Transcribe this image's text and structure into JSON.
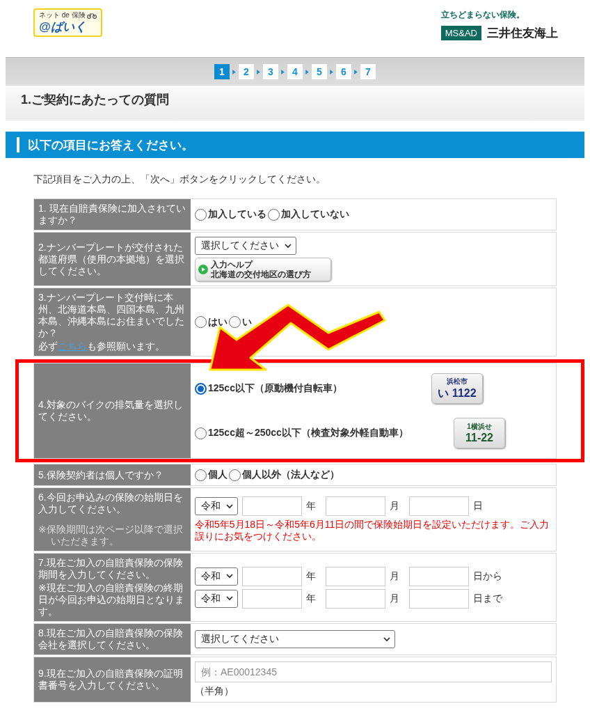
{
  "header": {
    "logo": {
      "tagline": "ネット de 保険",
      "name": "@ばいく"
    },
    "brand": {
      "slogan": "立ちどまらない保険。",
      "mark": "MS&AD",
      "company": "三井住友海上"
    }
  },
  "steps": [
    {
      "label": "1",
      "selected": true
    },
    {
      "label": "2",
      "selected": false
    },
    {
      "label": "3",
      "selected": false
    },
    {
      "label": "4",
      "selected": false
    },
    {
      "label": "5",
      "selected": false
    },
    {
      "label": "6",
      "selected": false
    },
    {
      "label": "7",
      "selected": false
    }
  ],
  "page_title": "1.ご契約にあたっての質問",
  "section_title": "以下の項目にお答えください。",
  "instructions": "下記項目をご入力の上、「次へ」ボタンをクリックしてください。",
  "questions": [
    {
      "kind": "radio",
      "label": "1. 現在自賠責保険に加入されていますか？",
      "highlighted": false,
      "options": [
        {
          "label": "加入している",
          "selected": false
        },
        {
          "label": "加入していない",
          "selected": false
        }
      ]
    },
    {
      "kind": "select",
      "label": "2.ナンバープレートが交付された都道府県（使用の本拠地）を選択してください。",
      "highlighted": false,
      "select": "選択してください",
      "help_button": {
        "line1": "入力ヘルプ",
        "line2": "北海道の交付地区の選び方"
      }
    },
    {
      "kind": "radio",
      "label": "3.ナンバープレート交付時に本州、北海道本島、四国本島、九州本島、沖縄本島にお住まいでしたか？",
      "note": {
        "before": "必ず",
        "link": "こちら",
        "after": "も参照願います。"
      },
      "highlighted": false,
      "options": [
        {
          "label": "はい",
          "selected": false
        },
        {
          "label": "い",
          "selected": false
        }
      ]
    },
    {
      "kind": "plates",
      "label": "4.対象のバイクの排気量を選択してください。",
      "highlighted": true,
      "options": [
        {
          "label": "125cc以下（原動機付自転車）",
          "selected": true,
          "plate": {
            "top": "浜松市",
            "bottom": "い 1122",
            "color": "#1f2c7c"
          }
        },
        {
          "label": "125cc超～250cc以下（検査対象外軽自動車）",
          "selected": false,
          "plate": {
            "top": "1横浜せ",
            "bottom": "11-22",
            "color": "#1f5a30"
          }
        }
      ]
    },
    {
      "kind": "radio",
      "label": "5.保険契約者は個人ですか？",
      "highlighted": false,
      "options": [
        {
          "label": "個人",
          "selected": false
        },
        {
          "label": "個人以外（法人など）",
          "selected": false
        }
      ]
    },
    {
      "kind": "date",
      "label": "6.今回お申込みの保険の始期日を入力してください。",
      "aside": "※保険期間は次ページ以降で選択いただきます。",
      "highlighted": false,
      "dates": [
        {
          "era": "令和",
          "year_unit": "年",
          "month_unit": "月",
          "day_unit": "日"
        }
      ],
      "warning": "令和5年5月18日～令和5年6月11日の間で保険始期日を設定いただけます。ご入力誤りにお気をつけください。"
    },
    {
      "kind": "date",
      "label": "7.現在ご加入の自賠責保険の保険期間を入力してください。",
      "sub": "※現在ご加入の自賠責保険の終期日が今回お申込の始期日となります。",
      "highlighted": false,
      "dates": [
        {
          "era": "令和",
          "year_unit": "年",
          "month_unit": "月",
          "day_unit": "日から"
        },
        {
          "era": "令和",
          "year_unit": "年",
          "month_unit": "月",
          "day_unit": "日まで"
        }
      ]
    },
    {
      "kind": "select_wide",
      "label": "8.現在ご加入の自賠責保険の保険会社を選択してください。",
      "highlighted": false,
      "select": "選択してください"
    },
    {
      "kind": "text",
      "label": "9.現在ご加入の自賠責保険の証明書番号を入力してください。",
      "highlighted": false,
      "placeholder": "例：AE00012345",
      "hint": "（半角）"
    }
  ]
}
